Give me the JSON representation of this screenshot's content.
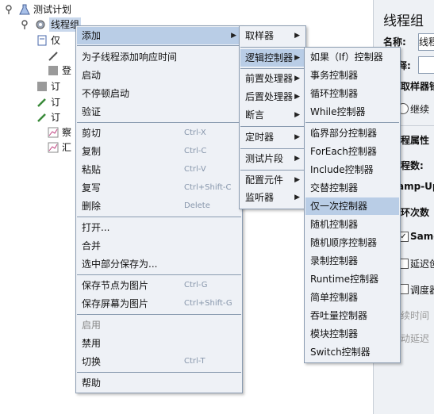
{
  "tree": {
    "root": "测试计划",
    "thread_group": "线程组",
    "child_1": "仅",
    "child_2": "登",
    "child_3": "订",
    "child_4": "订",
    "child_5": "订",
    "child_6": "察",
    "child_7": "汇"
  },
  "right_panel": {
    "title": "线程组",
    "name_label": "名称:",
    "name_value": "线程",
    "comment_label": "释:",
    "error_action_label": "取样器错",
    "continue_label": "继续",
    "thread_props_label": "程属性",
    "thread_count_label": "程数:",
    "ramp_up_label": "amp-Up",
    "loop_label": "环次数",
    "same_label": "Same",
    "delay_label": "延迟创",
    "scheduler_label": "调度器",
    "duration_label": "续时间",
    "startup_delay_label": "动延迟"
  },
  "context_menu": {
    "add": "添加",
    "add_think_time": "为子线程添加响应时间",
    "start": "启动",
    "start_no_pause": "不停顿启动",
    "validate": "验证",
    "cut": "剪切",
    "cut_accel": "Ctrl-X",
    "copy": "复制",
    "copy_accel": "Ctrl-C",
    "paste": "粘贴",
    "paste_accel": "Ctrl-V",
    "duplicate": "复写",
    "duplicate_accel": "Ctrl+Shift-C",
    "remove": "删除",
    "remove_accel": "Delete",
    "open": "打开...",
    "merge": "合并",
    "save_selection": "选中部分保存为...",
    "save_node_image": "保存节点为图片",
    "save_node_image_accel": "Ctrl-G",
    "save_screen_image": "保存屏幕为图片",
    "save_screen_image_accel": "Ctrl+Shift-G",
    "enable": "启用",
    "disable": "禁用",
    "toggle": "切换",
    "toggle_accel": "Ctrl-T",
    "help": "帮助"
  },
  "add_submenu": {
    "sampler": "取样器",
    "logic_controller": "逻辑控制器",
    "pre_processors": "前置处理器",
    "post_processors": "后置处理器",
    "assertions": "断言",
    "timer": "定时器",
    "test_fragment": "测试片段",
    "config_element": "配置元件",
    "listener": "监听器"
  },
  "logic_submenu": {
    "items": [
      "如果（If）控制器",
      "事务控制器",
      "循环控制器",
      "While控制器",
      "临界部分控制器",
      "ForEach控制器",
      "Include控制器",
      "交替控制器",
      "仅一次控制器",
      "随机控制器",
      "随机顺序控制器",
      "录制控制器",
      "Runtime控制器",
      "简单控制器",
      "吞吐量控制器",
      "模块控制器",
      "Switch控制器"
    ],
    "selected_index": 8
  },
  "colors": {
    "menu_bg": "#eef1f6",
    "selection": "#b9cde6",
    "accelerator": "#8796ab",
    "border": "#8a9bb0"
  }
}
